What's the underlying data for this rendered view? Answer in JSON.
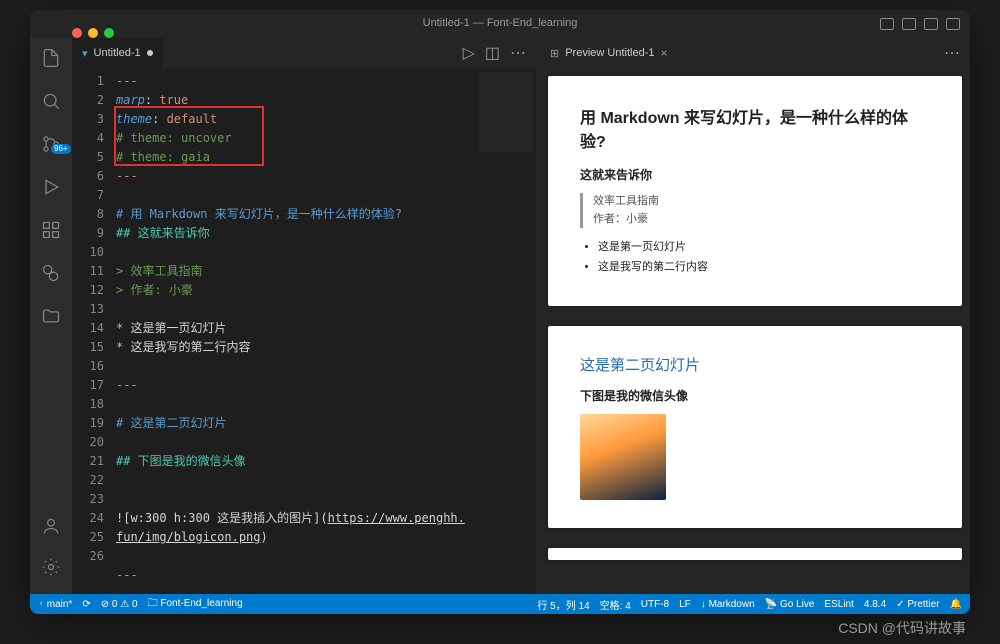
{
  "window": {
    "title": "Untitled-1 — Font-End_learning"
  },
  "traffic": {
    "close": "#ff5f57",
    "min": "#febc2e",
    "max": "#28c840"
  },
  "activity": {
    "scm_badge": "96+"
  },
  "editor": {
    "tab": {
      "name": "Untitled-1",
      "modified": true
    },
    "lines": [
      {
        "n": 1,
        "segs": [
          {
            "t": "---",
            "c": "c-str"
          }
        ]
      },
      {
        "n": 2,
        "segs": [
          {
            "t": "marp",
            "c": "c-key"
          },
          {
            "t": ": "
          },
          {
            "t": "true",
            "c": "c-str"
          }
        ]
      },
      {
        "n": 3,
        "segs": [
          {
            "t": "theme",
            "c": "c-key"
          },
          {
            "t": ": "
          },
          {
            "t": "default",
            "c": "c-str"
          }
        ]
      },
      {
        "n": 4,
        "segs": [
          {
            "t": "# theme: uncover",
            "c": "c-com"
          }
        ]
      },
      {
        "n": 5,
        "segs": [
          {
            "t": "# theme: gaia",
            "c": "c-com"
          }
        ]
      },
      {
        "n": 6,
        "segs": [
          {
            "t": "---",
            "c": "c-str"
          }
        ]
      },
      {
        "n": 7,
        "segs": []
      },
      {
        "n": 8,
        "segs": [
          {
            "t": "# 用 Markdown 来写幻灯片，是一种什么样的体验?",
            "c": "c-h1"
          }
        ]
      },
      {
        "n": 9,
        "segs": [
          {
            "t": "## 这就来告诉你",
            "c": "c-h2"
          }
        ]
      },
      {
        "n": 10,
        "segs": []
      },
      {
        "n": 11,
        "segs": [
          {
            "t": "> 效率工具指南",
            "c": "c-qt"
          }
        ]
      },
      {
        "n": 12,
        "segs": [
          {
            "t": "> 作者: 小豪",
            "c": "c-qt"
          }
        ]
      },
      {
        "n": 13,
        "segs": []
      },
      {
        "n": 14,
        "segs": [
          {
            "t": "* ",
            "c": "c-li"
          },
          {
            "t": "这是第一页幻灯片"
          }
        ]
      },
      {
        "n": 15,
        "segs": [
          {
            "t": "* ",
            "c": "c-li"
          },
          {
            "t": "这是我写的第二行内容"
          }
        ]
      },
      {
        "n": 16,
        "segs": []
      },
      {
        "n": 17,
        "segs": [
          {
            "t": "---",
            "c": "c-str"
          }
        ]
      },
      {
        "n": 18,
        "segs": []
      },
      {
        "n": 19,
        "segs": [
          {
            "t": "# 这是第二页幻灯片",
            "c": "c-h1"
          }
        ]
      },
      {
        "n": 20,
        "segs": []
      },
      {
        "n": 21,
        "segs": [
          {
            "t": "## 下图是我的微信头像",
            "c": "c-h2"
          }
        ]
      },
      {
        "n": 22,
        "segs": []
      },
      {
        "n": 23,
        "segs": []
      },
      {
        "n": 24,
        "segs": [
          {
            "t": "![w:300 h:300 这是我插入的图片]("
          },
          {
            "t": "https://www.penghh.",
            "c": "c-lnk"
          }
        ]
      },
      {
        "n": "",
        "segs": [
          {
            "t": "fun/img/blogicon.png",
            "c": "c-lnk"
          },
          {
            "t": ")"
          }
        ]
      },
      {
        "n": 25,
        "segs": []
      },
      {
        "n": 26,
        "segs": [
          {
            "t": "---",
            "c": "c-str"
          }
        ]
      }
    ]
  },
  "preview": {
    "tab": "Preview Untitled-1",
    "slide1": {
      "h1": "用 Markdown 来写幻灯片，是一种什么样的体验?",
      "h2": "这就来告诉你",
      "bq1": "效率工具指南",
      "bq2": "作者：小豪",
      "li1": "这是第一页幻灯片",
      "li2": "这是我写的第二行内容"
    },
    "slide2": {
      "h1": "这是第二页幻灯片",
      "h2": "下图是我的微信头像"
    }
  },
  "status": {
    "branch": "main*",
    "errors": "0",
    "warnings": "0",
    "folder": "Font-End_learning",
    "cursor": "行 5，列 14",
    "spaces": "空格: 4",
    "encoding": "UTF-8",
    "eol": "LF",
    "lang": "Markdown",
    "golive": "Go Live",
    "eslint": "ESLint",
    "ver": "4.8.4",
    "prettier": "Prettier"
  },
  "watermark": "CSDN @代码讲故事"
}
